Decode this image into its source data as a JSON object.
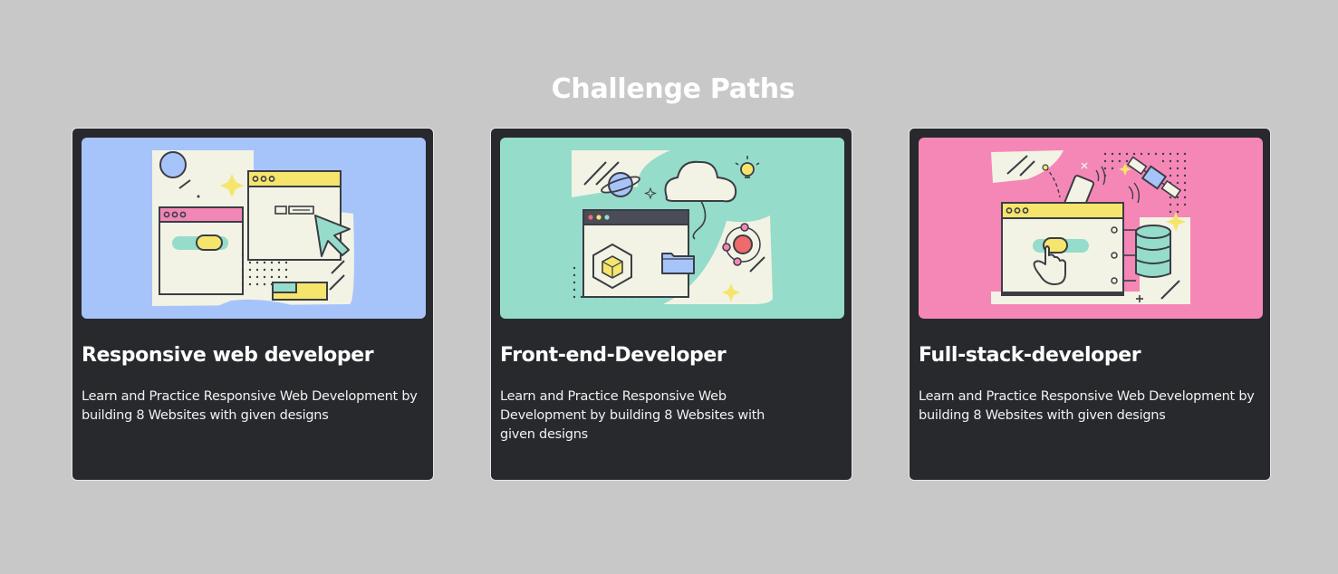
{
  "page": {
    "title": "Challenge Paths"
  },
  "colors": {
    "page_background": "#c8c8c8",
    "card_background": "#27292d",
    "card_border": "#e6e6e6",
    "title_color": "#ffffff"
  },
  "cards": [
    {
      "title": "Responsive web developer",
      "description": "Learn and Practice Responsive Web Development by building 8 Websites with given designs",
      "image_name": "responsive-web-illustration",
      "image_background": "#a7c4fa"
    },
    {
      "title": "Front-end-Developer",
      "description": "Learn and Practice Responsive Web Development by building 8 Websites with given designs",
      "image_name": "front-end-illustration",
      "image_background": "#95dccb"
    },
    {
      "title": "Full-stack-developer",
      "description": "Learn and Practice Responsive Web Development by building 8 Websites with given designs",
      "image_name": "full-stack-illustration",
      "image_background": "#f587b6"
    }
  ]
}
